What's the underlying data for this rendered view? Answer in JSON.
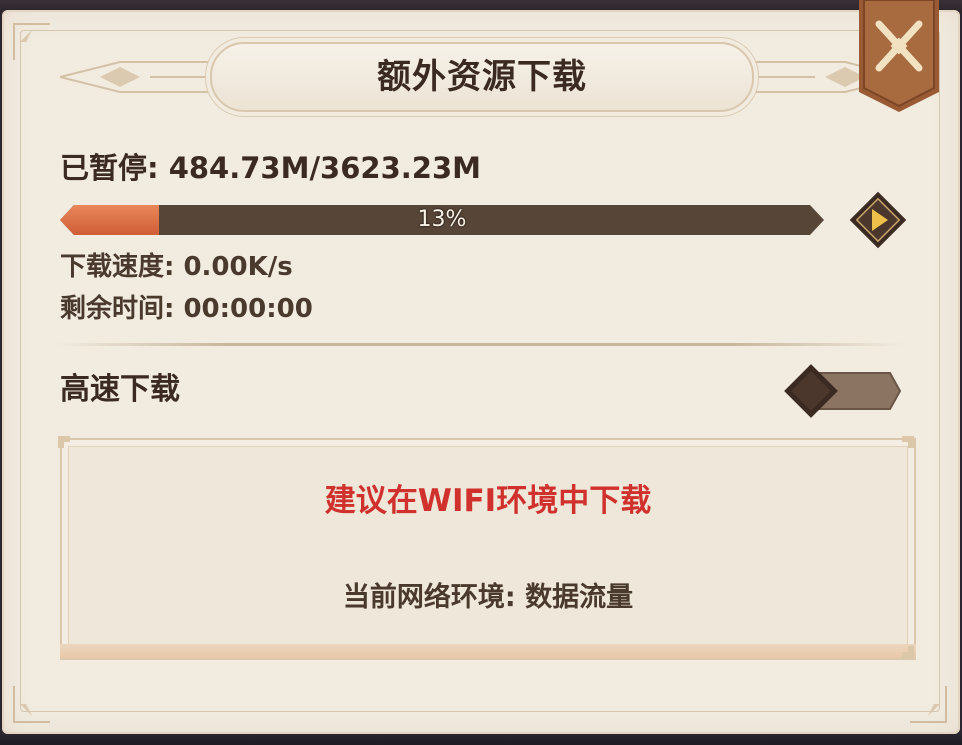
{
  "dialog": {
    "title": "额外资源下载"
  },
  "download": {
    "status_line": "已暂停: 484.73M/3623.23M",
    "progress_percent": 13,
    "progress_label": "13%",
    "speed_line": "下载速度: 0.00K/s",
    "remaining_line": "剩余时间: 00:00:00"
  },
  "fast_download": {
    "label": "高速下载",
    "enabled": false
  },
  "notice": {
    "warning": "建议在WIFI环境中下载",
    "network": "当前网络环境: 数据流量"
  },
  "icons": {
    "close": "close-x-icon",
    "play": "play-triangle-icon",
    "toggle": "diamond-toggle-icon"
  },
  "colors": {
    "panel_bg": "#f1ebe0",
    "text_dark": "#3a2a22",
    "progress_fill": "#d05d37",
    "progress_track": "#574538",
    "warning_red": "#d0312c",
    "close_button_brown": "#9a5a33"
  }
}
